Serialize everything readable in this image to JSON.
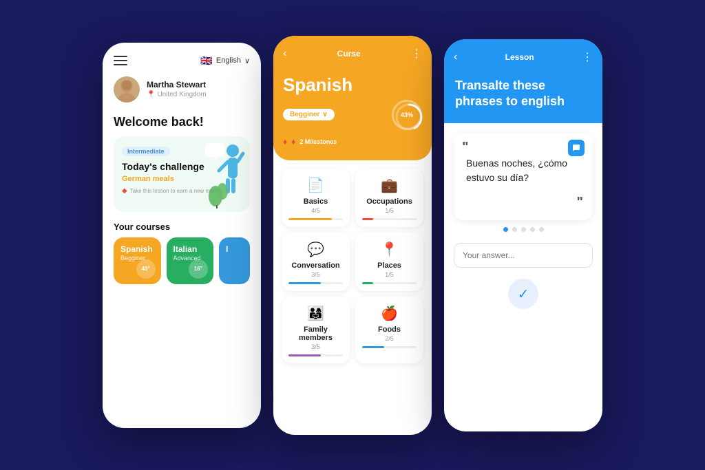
{
  "background": "#1a1a5e",
  "phone1": {
    "lang_label": "English",
    "lang_dropdown": "∨",
    "user_name": "Martha Stewart",
    "user_location": "United Kingdom",
    "welcome": "Welcome back!",
    "challenge": {
      "badge": "Intermediate",
      "title": "Today's challenge",
      "subtitle": "German meals",
      "hint": "Take this lesson to earn a new milestone"
    },
    "courses_label": "Your courses",
    "courses": [
      {
        "name": "Spanish",
        "level": "Begginer",
        "pct": "43°",
        "color": "orange"
      },
      {
        "name": "Italian",
        "level": "Advanced",
        "pct": "16°",
        "color": "green"
      },
      {
        "name": "I",
        "level": "",
        "pct": "",
        "color": "blue"
      }
    ]
  },
  "phone2": {
    "header_title": "Curse",
    "lang": "Spanish",
    "level": "Begginer",
    "progress_pct": "43%",
    "milestones": "2 Milestones",
    "lessons": [
      {
        "name": "Basics",
        "count": "4/5",
        "fill": "orange",
        "pct": 80,
        "icon": "📄"
      },
      {
        "name": "Occupations",
        "count": "1/5",
        "fill": "red",
        "pct": 20,
        "icon": "💼"
      },
      {
        "name": "Conversation",
        "count": "3/5",
        "fill": "blue",
        "pct": 60,
        "icon": "💬"
      },
      {
        "name": "Places",
        "count": "1/5",
        "fill": "green",
        "pct": 20,
        "icon": "📍"
      },
      {
        "name": "Family members",
        "count": "3/5",
        "fill": "purple",
        "pct": 60,
        "icon": "👨‍👩‍👧"
      },
      {
        "name": "Foods",
        "count": "2/5",
        "fill": "blue",
        "pct": 40,
        "icon": "🍎"
      }
    ]
  },
  "phone3": {
    "header_title": "Lesson",
    "question": "Transalte these phrases to english",
    "quote": "Buenas noches, ¿cómo estuvo su día?",
    "answer_placeholder": "Your answer...",
    "dots": 5,
    "active_dot": 0
  }
}
